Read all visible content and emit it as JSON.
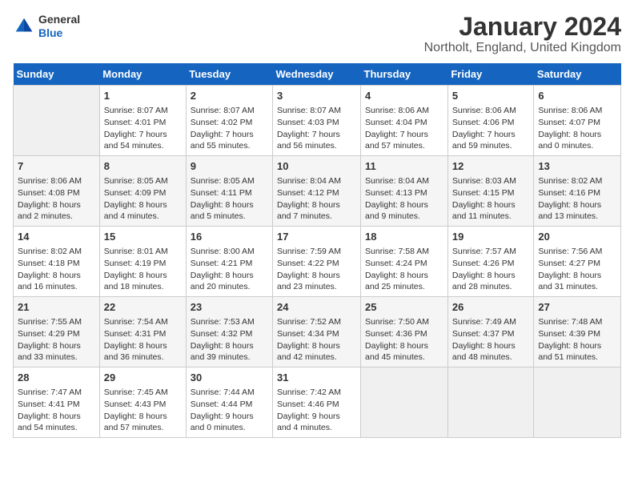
{
  "header": {
    "logo_line1": "General",
    "logo_line2": "Blue",
    "title": "January 2024",
    "subtitle": "Northolt, England, United Kingdom"
  },
  "days_of_week": [
    "Sunday",
    "Monday",
    "Tuesday",
    "Wednesday",
    "Thursday",
    "Friday",
    "Saturday"
  ],
  "weeks": [
    [
      {
        "day": "",
        "empty": true
      },
      {
        "day": "1",
        "sunrise": "8:07 AM",
        "sunset": "4:01 PM",
        "daylight": "7 hours and 54 minutes."
      },
      {
        "day": "2",
        "sunrise": "8:07 AM",
        "sunset": "4:02 PM",
        "daylight": "7 hours and 55 minutes."
      },
      {
        "day": "3",
        "sunrise": "8:07 AM",
        "sunset": "4:03 PM",
        "daylight": "7 hours and 56 minutes."
      },
      {
        "day": "4",
        "sunrise": "8:06 AM",
        "sunset": "4:04 PM",
        "daylight": "7 hours and 57 minutes."
      },
      {
        "day": "5",
        "sunrise": "8:06 AM",
        "sunset": "4:06 PM",
        "daylight": "7 hours and 59 minutes."
      },
      {
        "day": "6",
        "sunrise": "8:06 AM",
        "sunset": "4:07 PM",
        "daylight": "8 hours and 0 minutes."
      }
    ],
    [
      {
        "day": "7",
        "sunrise": "8:06 AM",
        "sunset": "4:08 PM",
        "daylight": "8 hours and 2 minutes."
      },
      {
        "day": "8",
        "sunrise": "8:05 AM",
        "sunset": "4:09 PM",
        "daylight": "8 hours and 4 minutes."
      },
      {
        "day": "9",
        "sunrise": "8:05 AM",
        "sunset": "4:11 PM",
        "daylight": "8 hours and 5 minutes."
      },
      {
        "day": "10",
        "sunrise": "8:04 AM",
        "sunset": "4:12 PM",
        "daylight": "8 hours and 7 minutes."
      },
      {
        "day": "11",
        "sunrise": "8:04 AM",
        "sunset": "4:13 PM",
        "daylight": "8 hours and 9 minutes."
      },
      {
        "day": "12",
        "sunrise": "8:03 AM",
        "sunset": "4:15 PM",
        "daylight": "8 hours and 11 minutes."
      },
      {
        "day": "13",
        "sunrise": "8:02 AM",
        "sunset": "4:16 PM",
        "daylight": "8 hours and 13 minutes."
      }
    ],
    [
      {
        "day": "14",
        "sunrise": "8:02 AM",
        "sunset": "4:18 PM",
        "daylight": "8 hours and 16 minutes."
      },
      {
        "day": "15",
        "sunrise": "8:01 AM",
        "sunset": "4:19 PM",
        "daylight": "8 hours and 18 minutes."
      },
      {
        "day": "16",
        "sunrise": "8:00 AM",
        "sunset": "4:21 PM",
        "daylight": "8 hours and 20 minutes."
      },
      {
        "day": "17",
        "sunrise": "7:59 AM",
        "sunset": "4:22 PM",
        "daylight": "8 hours and 23 minutes."
      },
      {
        "day": "18",
        "sunrise": "7:58 AM",
        "sunset": "4:24 PM",
        "daylight": "8 hours and 25 minutes."
      },
      {
        "day": "19",
        "sunrise": "7:57 AM",
        "sunset": "4:26 PM",
        "daylight": "8 hours and 28 minutes."
      },
      {
        "day": "20",
        "sunrise": "7:56 AM",
        "sunset": "4:27 PM",
        "daylight": "8 hours and 31 minutes."
      }
    ],
    [
      {
        "day": "21",
        "sunrise": "7:55 AM",
        "sunset": "4:29 PM",
        "daylight": "8 hours and 33 minutes."
      },
      {
        "day": "22",
        "sunrise": "7:54 AM",
        "sunset": "4:31 PM",
        "daylight": "8 hours and 36 minutes."
      },
      {
        "day": "23",
        "sunrise": "7:53 AM",
        "sunset": "4:32 PM",
        "daylight": "8 hours and 39 minutes."
      },
      {
        "day": "24",
        "sunrise": "7:52 AM",
        "sunset": "4:34 PM",
        "daylight": "8 hours and 42 minutes."
      },
      {
        "day": "25",
        "sunrise": "7:50 AM",
        "sunset": "4:36 PM",
        "daylight": "8 hours and 45 minutes."
      },
      {
        "day": "26",
        "sunrise": "7:49 AM",
        "sunset": "4:37 PM",
        "daylight": "8 hours and 48 minutes."
      },
      {
        "day": "27",
        "sunrise": "7:48 AM",
        "sunset": "4:39 PM",
        "daylight": "8 hours and 51 minutes."
      }
    ],
    [
      {
        "day": "28",
        "sunrise": "7:47 AM",
        "sunset": "4:41 PM",
        "daylight": "8 hours and 54 minutes."
      },
      {
        "day": "29",
        "sunrise": "7:45 AM",
        "sunset": "4:43 PM",
        "daylight": "8 hours and 57 minutes."
      },
      {
        "day": "30",
        "sunrise": "7:44 AM",
        "sunset": "4:44 PM",
        "daylight": "9 hours and 0 minutes."
      },
      {
        "day": "31",
        "sunrise": "7:42 AM",
        "sunset": "4:46 PM",
        "daylight": "9 hours and 4 minutes."
      },
      {
        "day": "",
        "empty": true
      },
      {
        "day": "",
        "empty": true
      },
      {
        "day": "",
        "empty": true
      }
    ]
  ]
}
